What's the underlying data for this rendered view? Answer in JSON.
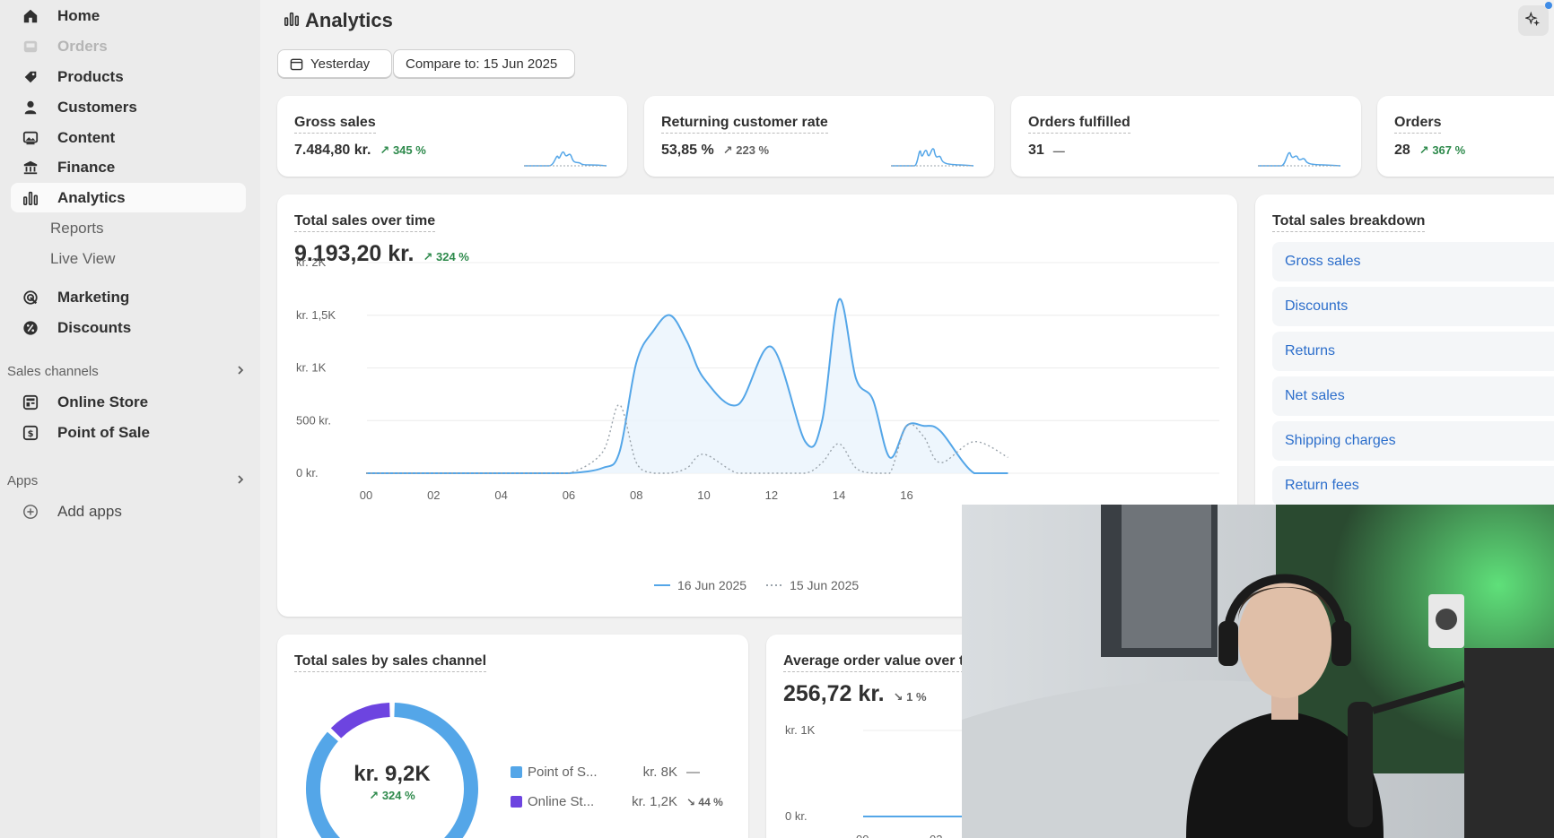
{
  "sidebar": {
    "items": [
      {
        "label": "Home",
        "icon": "home-icon"
      },
      {
        "label": "Orders",
        "icon": "inbox-icon"
      },
      {
        "label": "Products",
        "icon": "tag-icon"
      },
      {
        "label": "Customers",
        "icon": "person-icon"
      },
      {
        "label": "Content",
        "icon": "image-icon"
      },
      {
        "label": "Finance",
        "icon": "bank-icon"
      },
      {
        "label": "Analytics",
        "icon": "bar-chart-icon"
      }
    ],
    "analytics_sub": [
      "Reports",
      "Live View"
    ],
    "marketing": "Marketing",
    "discounts": "Discounts",
    "sales_channels_label": "Sales channels",
    "channels": [
      "Online Store",
      "Point of Sale"
    ],
    "apps_label": "Apps",
    "add_apps": "Add apps"
  },
  "header": {
    "title": "Analytics",
    "date_button": "Yesterday",
    "compare_button": "Compare to: 15 Jun 2025"
  },
  "metrics": [
    {
      "title": "Gross sales",
      "value": "7.484,80 kr.",
      "delta": "345 %"
    },
    {
      "title": "Returning customer rate",
      "value": "53,85 %",
      "delta": "223 %"
    },
    {
      "title": "Orders fulfilled",
      "value": "31",
      "delta": "—"
    },
    {
      "title": "Orders",
      "value": "28",
      "delta": "367 %"
    }
  ],
  "sales_over_time": {
    "title": "Total sales over time",
    "value": "9.193,20 kr.",
    "delta": "324 %",
    "legend": [
      "16 Jun 2025",
      "15 Jun 2025"
    ]
  },
  "breakdown": {
    "title": "Total sales breakdown",
    "rows": [
      "Gross sales",
      "Discounts",
      "Returns",
      "Net sales",
      "Shipping charges",
      "Return fees"
    ]
  },
  "by_channel": {
    "title": "Total sales by sales channel",
    "center_value": "kr. 9,2K",
    "center_delta": "324 %",
    "rows": [
      {
        "label": "Point of S...",
        "value": "kr. 8K",
        "delta": "—",
        "color": "#54a6e8"
      },
      {
        "label": "Online St...",
        "value": "kr. 1,2K",
        "delta": "44 %",
        "color": "#6d44e0"
      }
    ]
  },
  "aov": {
    "title": "Average order value over t",
    "value": "256,72 kr.",
    "delta": "1 %",
    "yticks": [
      "kr. 1K",
      "0 kr."
    ],
    "xticks": [
      "00",
      "02"
    ]
  },
  "chart_data": [
    {
      "type": "line",
      "title": "Total sales over time",
      "ylim": [
        0,
        2000
      ],
      "yticks": [
        "kr. 2K",
        "kr. 1,5K",
        "kr. 1K",
        "500 kr.",
        "0 kr."
      ],
      "xticks": [
        "00",
        "02",
        "04",
        "06",
        "08",
        "10",
        "12",
        "14",
        "16"
      ],
      "x": [
        0,
        1,
        2,
        3,
        4,
        5,
        6,
        7,
        7.5,
        8,
        8.5,
        9,
        9.5,
        10,
        11,
        12,
        13,
        13.5,
        14,
        14.5,
        15,
        15.5,
        16,
        16.5,
        17,
        18,
        19
      ],
      "series": [
        {
          "name": "16 Jun 2025",
          "style": "solid",
          "color": "#54a6e8",
          "values": [
            0,
            0,
            0,
            0,
            0,
            0,
            0,
            50,
            200,
            1050,
            1350,
            1500,
            1250,
            900,
            650,
            1200,
            300,
            500,
            1650,
            900,
            700,
            150,
            450,
            450,
            400,
            0,
            0
          ]
        },
        {
          "name": "15 Jun 2025",
          "style": "dotted",
          "color": "#9aa3ab",
          "values": [
            0,
            0,
            0,
            0,
            0,
            0,
            0,
            200,
            650,
            100,
            0,
            0,
            50,
            180,
            0,
            0,
            0,
            100,
            280,
            50,
            0,
            0,
            450,
            350,
            100,
            300,
            150
          ]
        }
      ]
    },
    {
      "type": "pie",
      "title": "Total sales by sales channel",
      "categories": [
        "Point of Sale",
        "Online Store"
      ],
      "values": [
        8000,
        1200
      ]
    }
  ]
}
